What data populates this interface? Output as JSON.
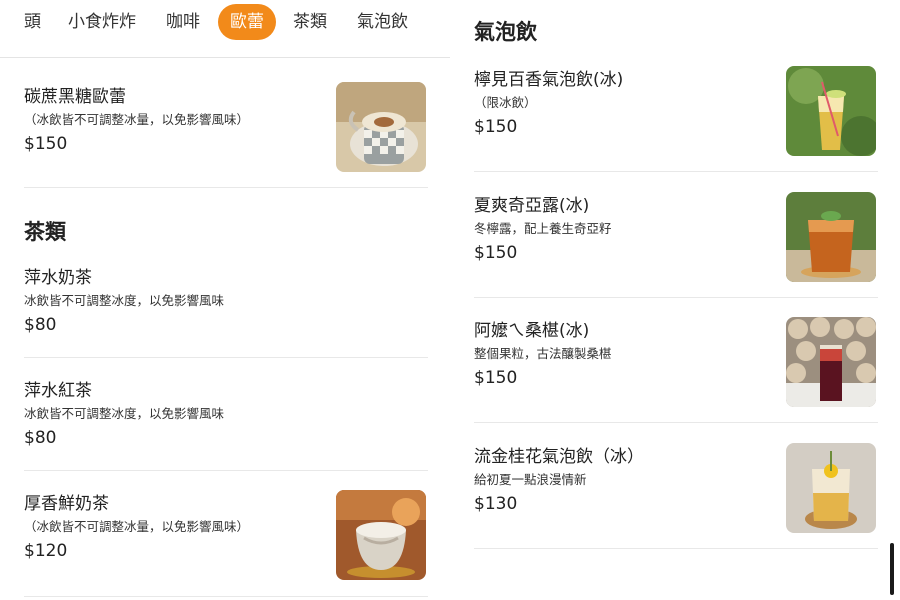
{
  "tabs": [
    {
      "label": "頭"
    },
    {
      "label": "小食炸炸"
    },
    {
      "label": "咖啡"
    },
    {
      "label": "歐蕾",
      "active": true
    },
    {
      "label": "茶類"
    },
    {
      "label": "氣泡飲"
    }
  ],
  "left": {
    "items_top": [
      {
        "name": "碳蔗黑糖歐蕾",
        "desc": "（冰飲皆不可調整冰量，以免影響風味）",
        "price": "$150"
      }
    ],
    "tea_section": {
      "title": "茶類",
      "items": [
        {
          "name": "萍水奶茶",
          "desc": "冰飲皆不可調整冰度，以免影響風味",
          "price": "$80"
        },
        {
          "name": "萍水紅茶",
          "desc": "冰飲皆不可調整冰度，以免影響風味",
          "price": "$80"
        },
        {
          "name": "厚香鮮奶茶",
          "desc": "（冰飲皆不可調整冰量，以免影響風味）",
          "price": "$120"
        }
      ]
    }
  },
  "right": {
    "sparkling_section": {
      "title": "氣泡飲",
      "items": [
        {
          "name": "檸見百香氣泡飲(冰)",
          "desc": "（限冰飲）",
          "price": "$150"
        },
        {
          "name": "夏爽奇亞露(冰)",
          "desc": "冬檸露，配上養生奇亞籽",
          "price": "$150"
        },
        {
          "name": "阿嬤ㄟ桑椹(冰)",
          "desc": "整個果粒，古法釀製桑椹",
          "price": "$150"
        },
        {
          "name": "流金桂花氣泡飲（冰）",
          "desc": "給初夏一點浪漫情新",
          "price": "$130"
        }
      ]
    }
  },
  "colors": {
    "accent": "#f28a1a",
    "divider": "#e8e8e8",
    "text": "#222222"
  },
  "icons": {
    "photo": "drink-photo-icon"
  }
}
